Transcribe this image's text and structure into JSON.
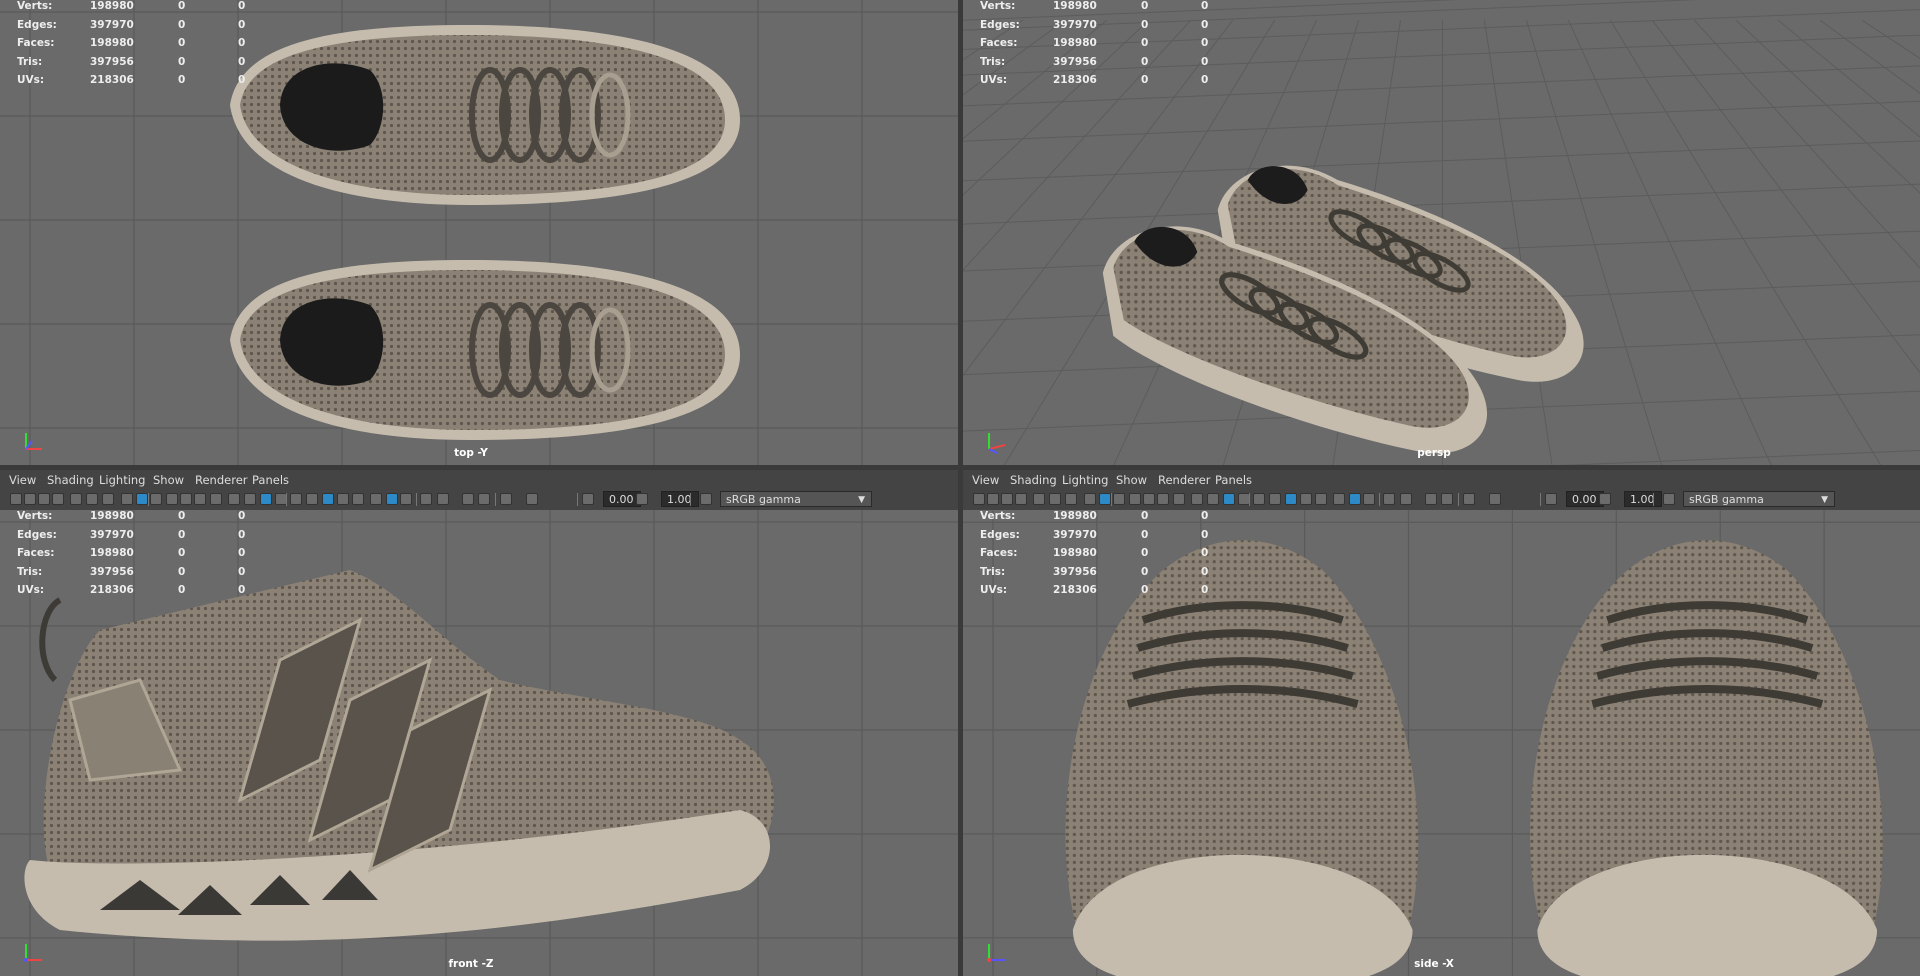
{
  "menu": {
    "view": "View",
    "shading": "Shading",
    "lighting": "Lighting",
    "show": "Show",
    "renderer": "Renderer",
    "panels": "Panels"
  },
  "toolbar": {
    "exposure": "0.00",
    "gamma": "1.00",
    "colorspace": "sRGB gamma"
  },
  "hud": {
    "verts_label": "Verts:",
    "verts": "198980",
    "edges_label": "Edges:",
    "edges": "397970",
    "faces_label": "Faces:",
    "faces": "198980",
    "tris_label": "Tris:",
    "tris": "397956",
    "uvs_label": "UVs:",
    "uvs": "218306",
    "zero": "0"
  },
  "cameras": {
    "top": "top -Y",
    "persp": "persp",
    "front": "front -Z",
    "side": "side -X"
  },
  "colors": {
    "viewport_bg": "#6a6a6a",
    "grid": "#5a5a5a",
    "shoe_upper": "#8b8175",
    "shoe_sole": "#c5bcae",
    "active_icon": "#2d8ac7"
  },
  "icons": [
    "camera-icon",
    "grid-icon",
    "shaded-icon",
    "wireframe-icon",
    "light-icon",
    "isolate-icon",
    "xray-icon",
    "exposure-icon",
    "gamma-icon",
    "colorspace-icon",
    "axis-icon"
  ]
}
